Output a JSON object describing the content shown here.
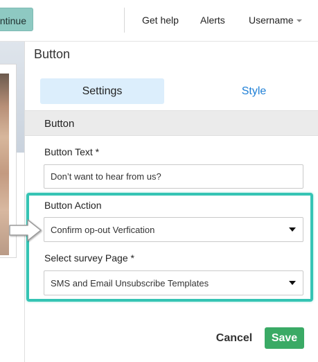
{
  "topbar": {
    "continue_label": "ntinue",
    "nav": {
      "get_help": "Get help",
      "alerts": "Alerts",
      "username": "Username"
    }
  },
  "panel": {
    "title": "Button",
    "tabs": [
      {
        "label": "Settings",
        "active": true
      },
      {
        "label": "Style",
        "active": false
      }
    ],
    "section_header": "Button",
    "fields": {
      "button_text": {
        "label": "Button Text *",
        "value": "Don’t want to hear from us?"
      },
      "button_action": {
        "label": "Button Action",
        "selected": "Confirm op-out Verfication"
      },
      "survey_page": {
        "label": "Select survey Page *",
        "selected": "SMS and Email Unsubscribe Templates"
      }
    },
    "footer": {
      "cancel_label": "Cancel",
      "save_label": "Save"
    }
  },
  "colors": {
    "continue_button": "#8ec9c2",
    "active_tab": "#dceefc",
    "link_blue": "#1e7fd6",
    "highlight": "#35c4b4",
    "save_green": "#3aaa65"
  },
  "icons": {
    "username_dropdown": "caret-down-icon",
    "select_dropdown": "triangle-down-icon",
    "annotation": "pointer-arrow-icon"
  }
}
